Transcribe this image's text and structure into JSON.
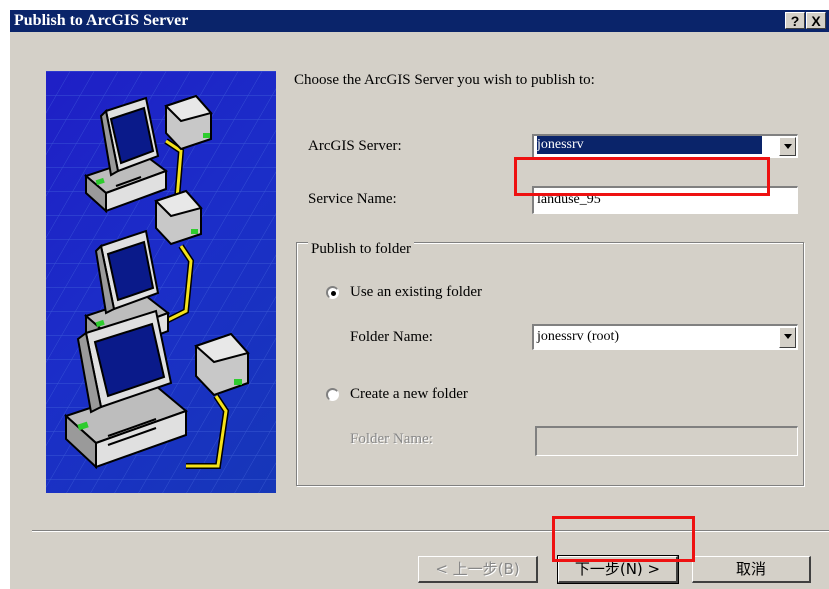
{
  "dialog": {
    "title": "Publish to ArcGIS Server",
    "help_label": "?",
    "close_label": "X"
  },
  "prompt": "Choose the ArcGIS Server you wish to publish to:",
  "server": {
    "label": "ArcGIS Server:",
    "value": "jonessrv"
  },
  "service": {
    "label": "Service Name:",
    "value": "landuse_95"
  },
  "folder_group": {
    "title": "Publish to folder",
    "existing_option": "Use an existing folder",
    "existing_selected": true,
    "folder_name_label": "Folder Name:",
    "folder_name_value": "jonessrv (root)",
    "new_option": "Create a new folder",
    "new_selected": false,
    "new_folder_name_label": "Folder Name:",
    "new_folder_name_value": ""
  },
  "buttons": {
    "back": "< 上一步(B)",
    "next": "下一步(N) >",
    "cancel": "取消"
  },
  "colors": {
    "titlebar": "#0a246a",
    "dialog_bg": "#d4d0c8",
    "highlight_box": "#ee1111",
    "illustration_bg": "#1f1fc6"
  }
}
